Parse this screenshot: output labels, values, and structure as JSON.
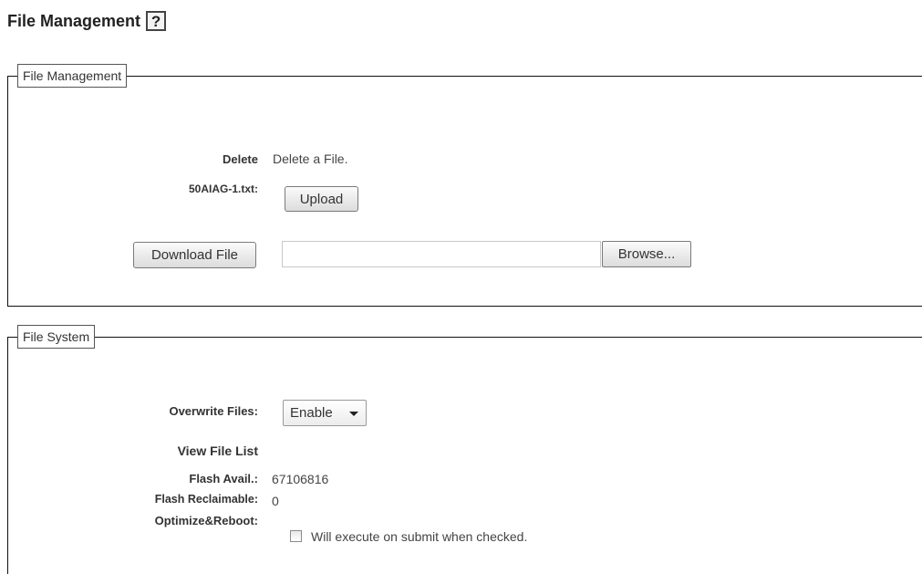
{
  "page": {
    "title": "File Management",
    "help_icon_glyph": "?"
  },
  "file_management": {
    "legend": "File Management",
    "delete_label": "Delete",
    "delete_text": "Delete a File.",
    "file_label": "50AIAG-1.txt:",
    "upload_button": "Upload",
    "download_button": "Download File",
    "file_path_value": "",
    "browse_button": "Browse..."
  },
  "file_system": {
    "legend": "File System",
    "overwrite_label": "Overwrite Files:",
    "overwrite_selected": "Enable",
    "view_file_list_label": "View File List",
    "flash_avail_label": "Flash Avail.:",
    "flash_avail_value": "67106816",
    "flash_reclaimable_label": "Flash Reclaimable:",
    "flash_reclaimable_value": "0",
    "optimize_label": "Optimize&Reboot:",
    "optimize_checked": false,
    "optimize_text": "Will execute on submit when checked."
  },
  "icons": {
    "help": "help-icon",
    "dropdown": "chevron-down-icon"
  }
}
